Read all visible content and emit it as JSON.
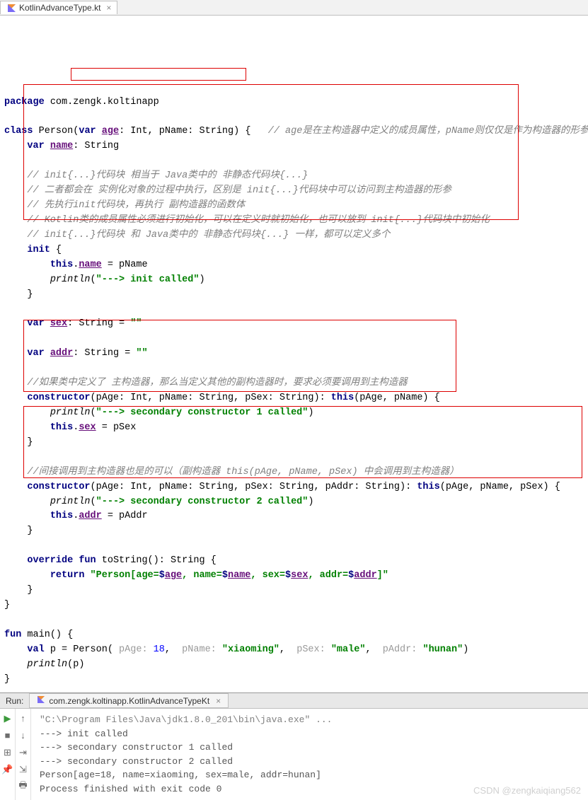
{
  "tab": {
    "filename": "KotlinAdvanceType.kt"
  },
  "code": {
    "package_kw": "package",
    "package_name": " com.zengk.koltinapp",
    "class_kw": "class",
    "class_name": " Person",
    "open_paren": "(",
    "var_kw": "var",
    "age_prop": "age",
    "colon_int": ": Int, pName: String",
    "close_paren": ")",
    "open_brace": " {   ",
    "class_comment": "// age是在主构造器中定义的成员属性，pName则仅仅是作为构造器的形参",
    "name_decl_var": "var",
    "name_decl_name": "name",
    "name_decl_type": ": String",
    "c1": "// init{...}代码块 相当于 Java类中的 非静态代码块{...}",
    "c2": "// 二者都会在 实例化对象的过程中执行，区别是 init{...}代码块中可以访问到主构造器的形参",
    "c3": "// 先执行init代码块，再执行 副构造器的函数体",
    "c4": "// Kotlin类的成员属性必须进行初始化，可以在定义时就初始化，也可以放到 init{...}代码块中初始化",
    "c5": "// init{...}代码块 和 Java类中的 非静态代码块{...} 一样，都可以定义多个",
    "init_kw": "init",
    "init_brace": " {",
    "this_kw1": "this",
    "name_assign": "name",
    "eq_pname": " = pName",
    "println1": "println",
    "str_init": "\"---> init called\"",
    "close_brace1": "}",
    "sex_var": "var",
    "sex_name": "sex",
    "sex_type": ": String = ",
    "sex_val": "\"\"",
    "addr_var": "var",
    "addr_name": "addr",
    "addr_type": ": String = ",
    "addr_val": "\"\"",
    "c6": "//如果类中定义了 主构造器，那么当定义其他的副构造器时，要求必须要调用到主构造器",
    "ctor_kw1": "constructor",
    "ctor1_sig": "(pAge: Int, pName: String, pSex: String): ",
    "this_call1_kw": "this",
    "this_call1": "(pAge, pName) {",
    "str_sec1": "\"---> secondary constructor 1 called\"",
    "this_kw2": "this",
    "sex_assign": "sex",
    "eq_psex": " = pSex",
    "close_brace2": "}",
    "c7": "//间接调用到主构造器也是的可以（副构造器 this(pAge, pName, pSex) 中会调用到主构造器）",
    "ctor_kw2": "constructor",
    "ctor2_sig": "(pAge: Int, pName: String, pSex: String, pAddr: String): ",
    "this_call2_kw": "this",
    "this_call2": "(pAge, pName, pSex) {",
    "str_sec2": "\"---> secondary constructor 2 called\"",
    "this_kw3": "this",
    "addr_assign": "addr",
    "eq_paddr": " = pAddr",
    "close_brace3": "}",
    "override_kw": "override",
    "fun_kw": "fun",
    "tostring": " toString(): String {",
    "return_kw": "return",
    "str_tostring_p1": "\"Person[age=",
    "dollar1": "$",
    "age_u": "age",
    "str_tostring_p2": ", name=",
    "dollar2": "$",
    "name_u": "name",
    "str_tostring_p3": ", sex=",
    "dollar3": "$",
    "sex_u": "sex",
    "str_tostring_p4": ", addr=",
    "dollar4": "$",
    "addr_u": "addr",
    "str_tostring_p5": "]\"",
    "close_brace4": "}",
    "close_brace5": "}",
    "main_fun_kw": "fun",
    "main_sig": " main() {",
    "val_kw": "val",
    "p_eq": " p = Person( ",
    "hint_page": "pAge: ",
    "arg_18": "18",
    "comma1": ",  ",
    "hint_pname": "pName: ",
    "arg_xiaoming": "\"xiaoming\"",
    "comma2": ",  ",
    "hint_psex": "pSex: ",
    "arg_male": "\"male\"",
    "comma3": ",  ",
    "hint_paddr": "pAddr: ",
    "arg_hunan": "\"hunan\"",
    "close_call": ")",
    "println_p_fn": "println",
    "println_p": "(p)",
    "close_brace_main": "}"
  },
  "run": {
    "label": "Run:",
    "config": "com.zengk.koltinapp.KotlinAdvanceTypeKt"
  },
  "output": {
    "l1": "\"C:\\Program Files\\Java\\jdk1.8.0_201\\bin\\java.exe\" ...",
    "l2": "---> init called",
    "l3": "---> secondary constructor 1 called",
    "l4": "---> secondary constructor 2 called",
    "l5": "Person[age=18, name=xiaoming, sex=male, addr=hunan]",
    "l6": "",
    "l7": "Process finished with exit code 0"
  },
  "watermark": "CSDN @zengkaiqiang562"
}
